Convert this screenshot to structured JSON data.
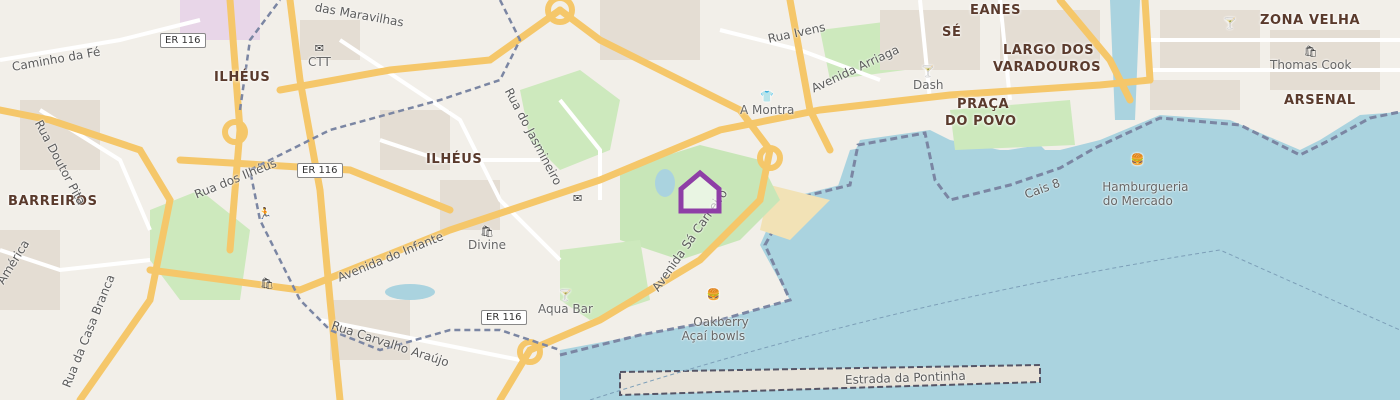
{
  "colors": {
    "water": "#aad3df",
    "land": "#f2efe9",
    "park": "#c8e6b8",
    "building": "#e0d8ce",
    "major_road": "#f5c76a",
    "road": "#ffffff",
    "boundary": "#7b86a3",
    "marker": "#8e3ea6"
  },
  "districts": [
    {
      "name": "ILHÉUS"
    },
    {
      "name": "ILHÉUS"
    },
    {
      "name": "BARREIROS"
    },
    {
      "name": "EANES"
    },
    {
      "name": "SÉ"
    },
    {
      "name": "LARGO DOS"
    },
    {
      "name": "VARADOUROS"
    },
    {
      "name": "PRAÇA"
    },
    {
      "name": "DO POVO"
    },
    {
      "name": "ZONA VELHA"
    },
    {
      "name": "ARSENAL"
    }
  ],
  "streets": [
    {
      "name": "das Maravilhas"
    },
    {
      "name": "Caminho da Fé"
    },
    {
      "name": "Rua Doutor Pita"
    },
    {
      "name": "Rua dos Ilhéus"
    },
    {
      "name": "Rua do Jasmineiro"
    },
    {
      "name": "Avenida do Infante"
    },
    {
      "name": "Rua Carvalho Araújo"
    },
    {
      "name": "Rua da Casa Branca"
    },
    {
      "name": "América"
    },
    {
      "name": "Avenida Sá Carneiro"
    },
    {
      "name": "Avenida Arriaga"
    },
    {
      "name": "Rua Ivens"
    },
    {
      "name": "Cais 8"
    },
    {
      "name": "Estrada da Pontinha"
    }
  ],
  "route_shields": [
    "ER 116",
    "ER 116",
    "ER 116"
  ],
  "pois": [
    {
      "name": "CTT",
      "icon": "envelope-icon",
      "glyph": "✉"
    },
    {
      "name": "Divine",
      "icon": "shopping-bag-icon",
      "glyph": "🛍"
    },
    {
      "name": "Aqua Bar",
      "icon": "cocktail-icon",
      "glyph": "🍸"
    },
    {
      "name": "A Montra",
      "icon": "clothing-icon",
      "glyph": "👕"
    },
    {
      "name": "Dash",
      "icon": "cocktail-icon",
      "glyph": "🍸"
    },
    {
      "name": "Oakberry\nAçaí bowls",
      "icon": "fast-food-icon",
      "glyph": "🍔"
    },
    {
      "name": "Hamburgueria\ndo Mercado",
      "icon": "fast-food-icon",
      "glyph": "🍔"
    },
    {
      "name": "Thomas Cook",
      "icon": "shopping-bag-icon",
      "glyph": "🛍"
    },
    {
      "name": "",
      "icon": "cocktail-icon",
      "glyph": "🍸"
    },
    {
      "name": "",
      "icon": "envelope-icon",
      "glyph": "✉"
    },
    {
      "name": "",
      "icon": "shopping-bag-icon",
      "glyph": "🛍"
    },
    {
      "name": "",
      "icon": "fitness-icon",
      "glyph": "🏃"
    }
  ],
  "marker": {
    "icon": "house-marker-icon"
  }
}
